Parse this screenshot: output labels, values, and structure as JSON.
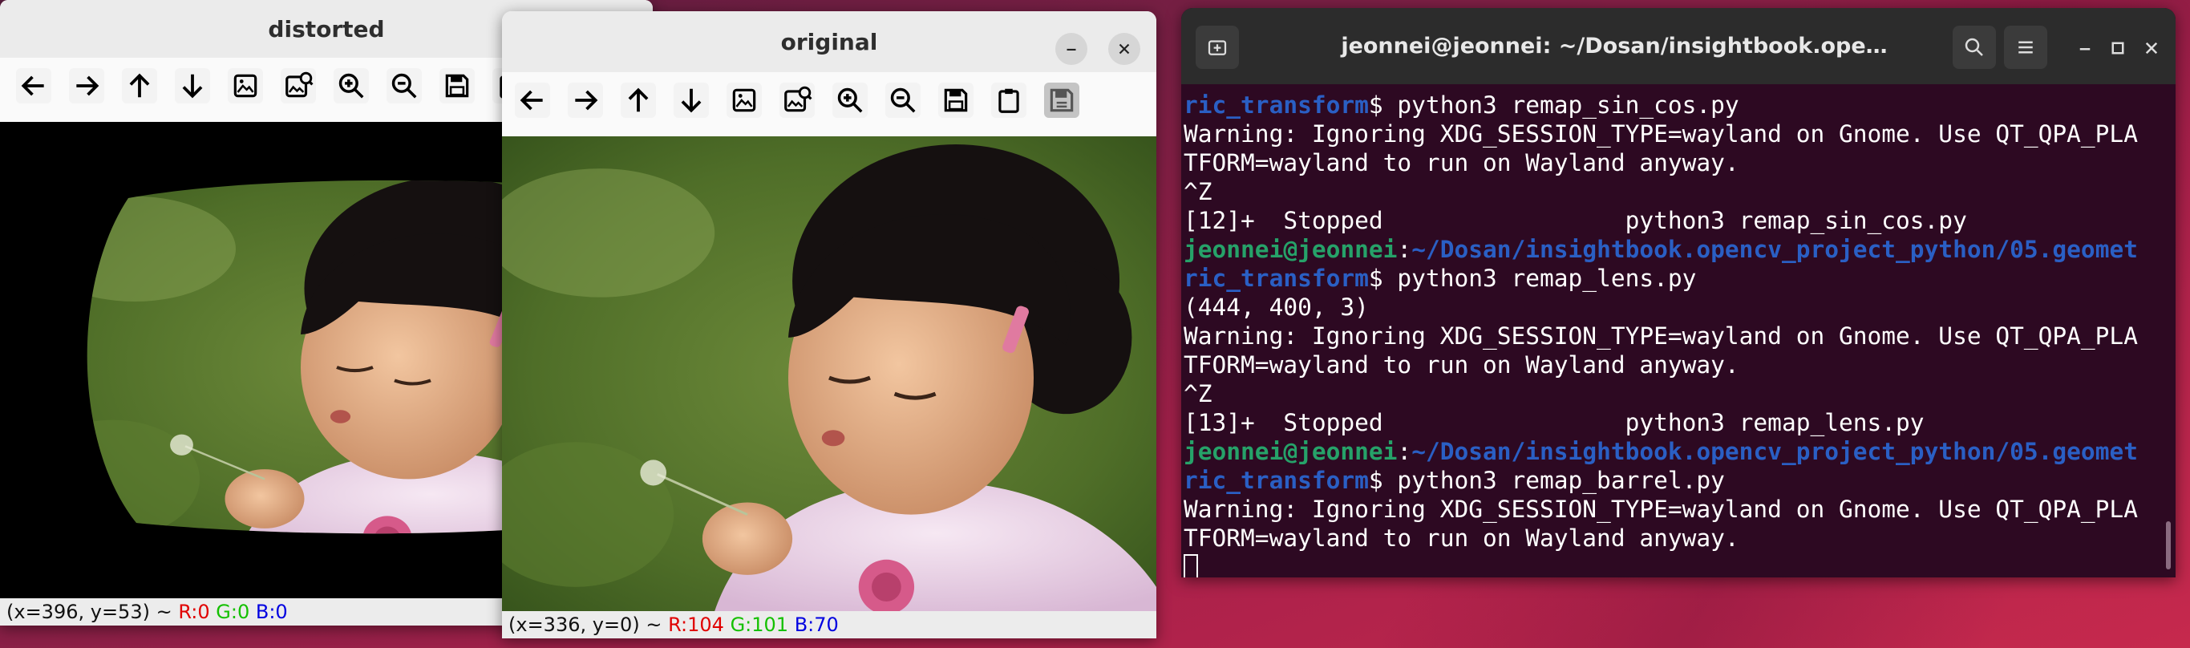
{
  "windows": {
    "distorted": {
      "title": "distorted",
      "status": {
        "coords": "(x=396, y=53) ~",
        "r": "R:0",
        "g": "G:0",
        "b": "B:0"
      }
    },
    "original": {
      "title": "original",
      "status": {
        "coords": "(x=336, y=0) ~",
        "r": "R:104",
        "g": "G:101",
        "b": "B:70"
      }
    }
  },
  "toolbar_icons": [
    "pan-left-icon",
    "pan-right-icon",
    "pan-up-icon",
    "pan-down-icon",
    "zoom-fit-icon",
    "zoom-to-image-icon",
    "zoom-in-icon",
    "zoom-out-icon",
    "save-icon",
    "copy-clipboard-icon",
    "properties-icon"
  ],
  "terminal": {
    "title": "jeonnei@jeonnei: ~/Dosan/insightbook.ope…",
    "lines": [
      {
        "kind": "plain",
        "text": "ric_transform$ python3 remap_sin_cos.py",
        "path": "ric_transform",
        "rest": "$ python3 remap_sin_cos.py"
      },
      {
        "kind": "plain",
        "text": "Warning: Ignoring XDG_SESSION_TYPE=wayland on Gnome. Use QT_QPA_PLA"
      },
      {
        "kind": "plain",
        "text": "TFORM=wayland to run on Wayland anyway."
      },
      {
        "kind": "plain",
        "text": "^Z"
      },
      {
        "kind": "plain",
        "text": "[12]+  Stopped                 python3 remap_sin_cos.py"
      },
      {
        "kind": "prompt",
        "user": "jeonnei@jeonnei",
        "sep": ":",
        "path": "~/Dosan/insightbook.opencv_project_python/05.geomet"
      },
      {
        "kind": "cmd",
        "path": "ric_transform",
        "rest": "$ python3 remap_lens.py"
      },
      {
        "kind": "plain",
        "text": "(444, 400, 3)"
      },
      {
        "kind": "plain",
        "text": "Warning: Ignoring XDG_SESSION_TYPE=wayland on Gnome. Use QT_QPA_PLA"
      },
      {
        "kind": "plain",
        "text": "TFORM=wayland to run on Wayland anyway."
      },
      {
        "kind": "plain",
        "text": "^Z"
      },
      {
        "kind": "plain",
        "text": "[13]+  Stopped                 python3 remap_lens.py"
      },
      {
        "kind": "prompt",
        "user": "jeonnei@jeonnei",
        "sep": ":",
        "path": "~/Dosan/insightbook.opencv_project_python/05.geomet"
      },
      {
        "kind": "cmd",
        "path": "ric_transform",
        "rest": "$ python3 remap_barrel.py"
      },
      {
        "kind": "plain",
        "text": "Warning: Ignoring XDG_SESSION_TYPE=wayland on Gnome. Use QT_QPA_PLA"
      },
      {
        "kind": "plain",
        "text": "TFORM=wayland to run on Wayland anyway."
      }
    ]
  },
  "colors": {
    "prompt_user": "#26a269",
    "prompt_path": "#2a5fc4",
    "terminal_bg": "#2d0922",
    "status_r": "#e00000",
    "status_g": "#14c000",
    "status_b": "#0000e0"
  }
}
